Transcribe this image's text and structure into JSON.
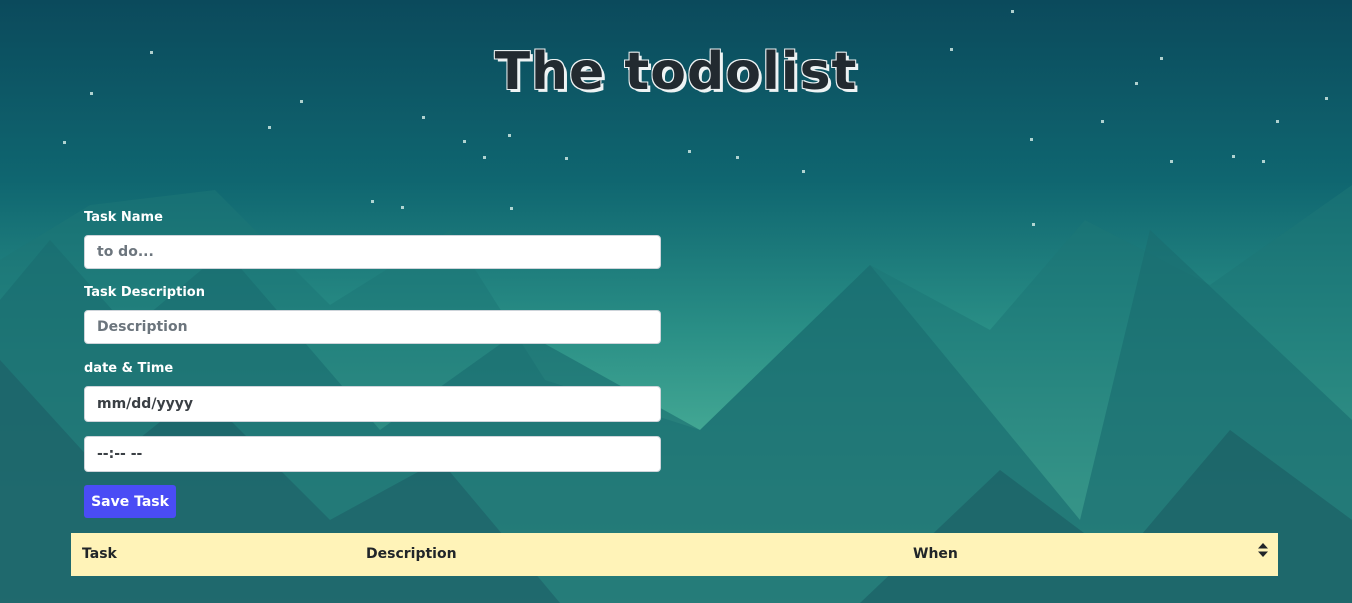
{
  "header": {
    "title": "The todolist"
  },
  "form": {
    "task_name_label": "Task Name",
    "task_name_placeholder": "to do...",
    "task_description_label": "Task Description",
    "task_description_placeholder": "Description",
    "datetime_label": "date & Time",
    "date_value": "mm/dd/yyyy",
    "time_value": "--:-- --",
    "save_label": "Save Task",
    "save_color": "#4a4cf5"
  },
  "table": {
    "header_color": "#fff3b8",
    "columns": [
      "Task",
      "Description",
      "When"
    ],
    "sort_icon": "sort-icon"
  }
}
